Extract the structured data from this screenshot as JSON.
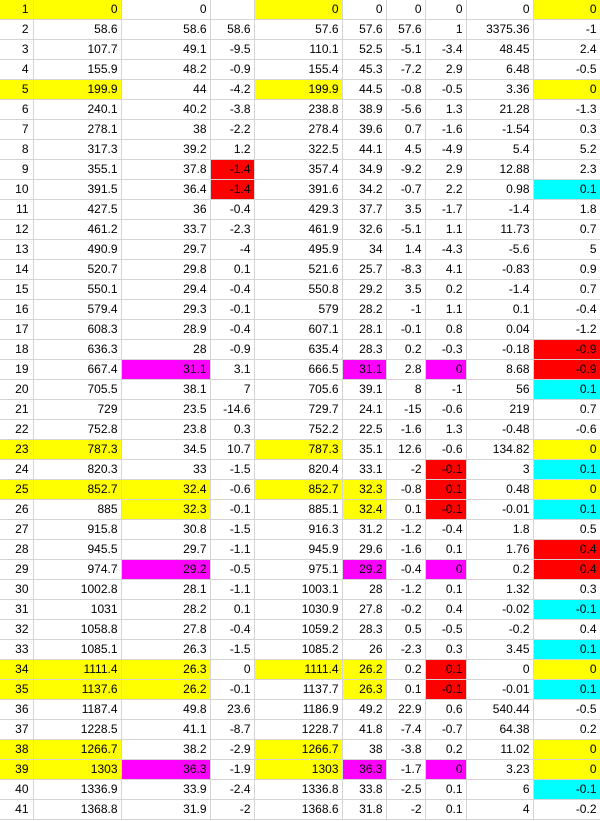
{
  "palette": {
    "Y": "#ffff00",
    "M": "#ff00ff",
    "R": "#ff0000",
    "C": "#00ffff"
  },
  "rows": [
    {
      "v": [
        "1",
        "0",
        "0",
        "",
        "0",
        "0",
        "0",
        "0",
        "0",
        "0"
      ],
      "h": [
        "Y",
        "Y",
        "",
        "",
        "Y",
        "",
        "",
        "",
        "",
        "Y"
      ]
    },
    {
      "v": [
        "2",
        "58.6",
        "58.6",
        "58.6",
        "57.6",
        "57.6",
        "57.6",
        "1",
        "3375.36",
        "-1"
      ],
      "h": [
        "",
        "",
        "",
        "",
        "",
        "",
        "",
        "",
        "",
        ""
      ]
    },
    {
      "v": [
        "3",
        "107.7",
        "49.1",
        "-9.5",
        "110.1",
        "52.5",
        "-5.1",
        "-3.4",
        "48.45",
        "2.4"
      ],
      "h": [
        "",
        "",
        "",
        "",
        "",
        "",
        "",
        "",
        "",
        ""
      ]
    },
    {
      "v": [
        "4",
        "155.9",
        "48.2",
        "-0.9",
        "155.4",
        "45.3",
        "-7.2",
        "2.9",
        "6.48",
        "-0.5"
      ],
      "h": [
        "",
        "",
        "",
        "",
        "",
        "",
        "",
        "",
        "",
        ""
      ]
    },
    {
      "v": [
        "5",
        "199.9",
        "44",
        "-4.2",
        "199.9",
        "44.5",
        "-0.8",
        "-0.5",
        "3.36",
        "0"
      ],
      "h": [
        "Y",
        "Y",
        "",
        "",
        "Y",
        "",
        "",
        "",
        "",
        "Y"
      ]
    },
    {
      "v": [
        "6",
        "240.1",
        "40.2",
        "-3.8",
        "238.8",
        "38.9",
        "-5.6",
        "1.3",
        "21.28",
        "-1.3"
      ],
      "h": [
        "",
        "",
        "",
        "",
        "",
        "",
        "",
        "",
        "",
        ""
      ]
    },
    {
      "v": [
        "7",
        "278.1",
        "38",
        "-2.2",
        "278.4",
        "39.6",
        "0.7",
        "-1.6",
        "-1.54",
        "0.3"
      ],
      "h": [
        "",
        "",
        "",
        "",
        "",
        "",
        "",
        "",
        "",
        ""
      ]
    },
    {
      "v": [
        "8",
        "317.3",
        "39.2",
        "1.2",
        "322.5",
        "44.1",
        "4.5",
        "-4.9",
        "5.4",
        "5.2"
      ],
      "h": [
        "",
        "",
        "",
        "",
        "",
        "",
        "",
        "",
        "",
        ""
      ]
    },
    {
      "v": [
        "9",
        "355.1",
        "37.8",
        "-1.4",
        "357.4",
        "34.9",
        "-9.2",
        "2.9",
        "12.88",
        "2.3"
      ],
      "h": [
        "",
        "",
        "",
        "R",
        "",
        "",
        "",
        "",
        "",
        ""
      ]
    },
    {
      "v": [
        "10",
        "391.5",
        "36.4",
        "-1.4",
        "391.6",
        "34.2",
        "-0.7",
        "2.2",
        "0.98",
        "0.1"
      ],
      "h": [
        "",
        "",
        "",
        "R",
        "",
        "",
        "",
        "",
        "",
        "C"
      ]
    },
    {
      "v": [
        "11",
        "427.5",
        "36",
        "-0.4",
        "429.3",
        "37.7",
        "3.5",
        "-1.7",
        "-1.4",
        "1.8"
      ],
      "h": [
        "",
        "",
        "",
        "",
        "",
        "",
        "",
        "",
        "",
        ""
      ]
    },
    {
      "v": [
        "12",
        "461.2",
        "33.7",
        "-2.3",
        "461.9",
        "32.6",
        "-5.1",
        "1.1",
        "11.73",
        "0.7"
      ],
      "h": [
        "",
        "",
        "",
        "",
        "",
        "",
        "",
        "",
        "",
        ""
      ]
    },
    {
      "v": [
        "13",
        "490.9",
        "29.7",
        "-4",
        "495.9",
        "34",
        "1.4",
        "-4.3",
        "-5.6",
        "5"
      ],
      "h": [
        "",
        "",
        "",
        "",
        "",
        "",
        "",
        "",
        "",
        ""
      ]
    },
    {
      "v": [
        "14",
        "520.7",
        "29.8",
        "0.1",
        "521.6",
        "25.7",
        "-8.3",
        "4.1",
        "-0.83",
        "0.9"
      ],
      "h": [
        "",
        "",
        "",
        "",
        "",
        "",
        "",
        "",
        "",
        ""
      ]
    },
    {
      "v": [
        "15",
        "550.1",
        "29.4",
        "-0.4",
        "550.8",
        "29.2",
        "3.5",
        "0.2",
        "-1.4",
        "0.7"
      ],
      "h": [
        "",
        "",
        "",
        "",
        "",
        "",
        "",
        "",
        "",
        ""
      ]
    },
    {
      "v": [
        "16",
        "579.4",
        "29.3",
        "-0.1",
        "579",
        "28.2",
        "-1",
        "1.1",
        "0.1",
        "-0.4"
      ],
      "h": [
        "",
        "",
        "",
        "",
        "",
        "",
        "",
        "",
        "",
        ""
      ]
    },
    {
      "v": [
        "17",
        "608.3",
        "28.9",
        "-0.4",
        "607.1",
        "28.1",
        "-0.1",
        "0.8",
        "0.04",
        "-1.2"
      ],
      "h": [
        "",
        "",
        "",
        "",
        "",
        "",
        "",
        "",
        "",
        ""
      ]
    },
    {
      "v": [
        "18",
        "636.3",
        "28",
        "-0.9",
        "635.4",
        "28.3",
        "0.2",
        "-0.3",
        "-0.18",
        "-0.9"
      ],
      "h": [
        "",
        "",
        "",
        "",
        "",
        "",
        "",
        "",
        "",
        "R"
      ]
    },
    {
      "v": [
        "19",
        "667.4",
        "31.1",
        "3.1",
        "666.5",
        "31.1",
        "2.8",
        "0",
        "8.68",
        "-0.9"
      ],
      "h": [
        "",
        "",
        "M",
        "",
        "",
        "M",
        "",
        "M",
        "",
        "R"
      ]
    },
    {
      "v": [
        "20",
        "705.5",
        "38.1",
        "7",
        "705.6",
        "39.1",
        "8",
        "-1",
        "56",
        "0.1"
      ],
      "h": [
        "",
        "",
        "",
        "",
        "",
        "",
        "",
        "",
        "",
        "C"
      ]
    },
    {
      "v": [
        "21",
        "729",
        "23.5",
        "-14.6",
        "729.7",
        "24.1",
        "-15",
        "-0.6",
        "219",
        "0.7"
      ],
      "h": [
        "",
        "",
        "",
        "",
        "",
        "",
        "",
        "",
        "",
        ""
      ]
    },
    {
      "v": [
        "22",
        "752.8",
        "23.8",
        "0.3",
        "752.2",
        "22.5",
        "-1.6",
        "1.3",
        "-0.48",
        "-0.6"
      ],
      "h": [
        "",
        "",
        "",
        "",
        "",
        "",
        "",
        "",
        "",
        ""
      ]
    },
    {
      "v": [
        "23",
        "787.3",
        "34.5",
        "10.7",
        "787.3",
        "35.1",
        "12.6",
        "-0.6",
        "134.82",
        "0"
      ],
      "h": [
        "Y",
        "Y",
        "",
        "",
        "Y",
        "",
        "",
        "",
        "",
        "Y"
      ]
    },
    {
      "v": [
        "24",
        "820.3",
        "33",
        "-1.5",
        "820.4",
        "33.1",
        "-2",
        "-0.1",
        "3",
        "0.1"
      ],
      "h": [
        "",
        "",
        "",
        "",
        "",
        "",
        "",
        "R",
        "",
        "C"
      ]
    },
    {
      "v": [
        "25",
        "852.7",
        "32.4",
        "-0.6",
        "852.7",
        "32.3",
        "-0.8",
        "0.1",
        "0.48",
        "0"
      ],
      "h": [
        "Y",
        "Y",
        "Y",
        "",
        "Y",
        "Y",
        "",
        "R",
        "",
        "Y"
      ]
    },
    {
      "v": [
        "26",
        "885",
        "32.3",
        "-0.1",
        "885.1",
        "32.4",
        "0.1",
        "-0.1",
        "-0.01",
        "0.1"
      ],
      "h": [
        "",
        "",
        "Y",
        "",
        "",
        "Y",
        "",
        "R",
        "",
        "C"
      ]
    },
    {
      "v": [
        "27",
        "915.8",
        "30.8",
        "-1.5",
        "916.3",
        "31.2",
        "-1.2",
        "-0.4",
        "1.8",
        "0.5"
      ],
      "h": [
        "",
        "",
        "",
        "",
        "",
        "",
        "",
        "",
        "",
        ""
      ]
    },
    {
      "v": [
        "28",
        "945.5",
        "29.7",
        "-1.1",
        "945.9",
        "29.6",
        "-1.6",
        "0.1",
        "1.76",
        "0.4"
      ],
      "h": [
        "",
        "",
        "",
        "",
        "",
        "",
        "",
        "",
        "",
        "R"
      ]
    },
    {
      "v": [
        "29",
        "974.7",
        "29.2",
        "-0.5",
        "975.1",
        "29.2",
        "-0.4",
        "0",
        "0.2",
        "0.4"
      ],
      "h": [
        "",
        "",
        "M",
        "",
        "",
        "M",
        "",
        "M",
        "",
        "R"
      ]
    },
    {
      "v": [
        "30",
        "1002.8",
        "28.1",
        "-1.1",
        "1003.1",
        "28",
        "-1.2",
        "0.1",
        "1.32",
        "0.3"
      ],
      "h": [
        "",
        "",
        "",
        "",
        "",
        "",
        "",
        "",
        "",
        ""
      ]
    },
    {
      "v": [
        "31",
        "1031",
        "28.2",
        "0.1",
        "1030.9",
        "27.8",
        "-0.2",
        "0.4",
        "-0.02",
        "-0.1"
      ],
      "h": [
        "",
        "",
        "",
        "",
        "",
        "",
        "",
        "",
        "",
        "C"
      ]
    },
    {
      "v": [
        "32",
        "1058.8",
        "27.8",
        "-0.4",
        "1059.2",
        "28.3",
        "0.5",
        "-0.5",
        "-0.2",
        "0.4"
      ],
      "h": [
        "",
        "",
        "",
        "",
        "",
        "",
        "",
        "",
        "",
        ""
      ]
    },
    {
      "v": [
        "33",
        "1085.1",
        "26.3",
        "-1.5",
        "1085.2",
        "26",
        "-2.3",
        "0.3",
        "3.45",
        "0.1"
      ],
      "h": [
        "",
        "",
        "",
        "",
        "",
        "",
        "",
        "",
        "",
        "C"
      ]
    },
    {
      "v": [
        "34",
        "1111.4",
        "26.3",
        "0",
        "1111.4",
        "26.2",
        "0.2",
        "0.1",
        "0",
        "0"
      ],
      "h": [
        "Y",
        "Y",
        "Y",
        "",
        "Y",
        "Y",
        "",
        "R",
        "",
        "Y"
      ]
    },
    {
      "v": [
        "35",
        "1137.6",
        "26.2",
        "-0.1",
        "1137.7",
        "26.3",
        "0.1",
        "-0.1",
        "-0.01",
        "0.1"
      ],
      "h": [
        "Y",
        "Y",
        "Y",
        "",
        "",
        "Y",
        "",
        "R",
        "",
        "C"
      ]
    },
    {
      "v": [
        "36",
        "1187.4",
        "49.8",
        "23.6",
        "1186.9",
        "49.2",
        "22.9",
        "0.6",
        "540.44",
        "-0.5"
      ],
      "h": [
        "",
        "",
        "",
        "",
        "",
        "",
        "",
        "",
        "",
        ""
      ]
    },
    {
      "v": [
        "37",
        "1228.5",
        "41.1",
        "-8.7",
        "1228.7",
        "41.8",
        "-7.4",
        "-0.7",
        "64.38",
        "0.2"
      ],
      "h": [
        "",
        "",
        "",
        "",
        "",
        "",
        "",
        "",
        "",
        ""
      ]
    },
    {
      "v": [
        "38",
        "1266.7",
        "38.2",
        "-2.9",
        "1266.7",
        "38",
        "-3.8",
        "0.2",
        "11.02",
        "0"
      ],
      "h": [
        "Y",
        "Y",
        "",
        "",
        "Y",
        "",
        "",
        "",
        "",
        "Y"
      ]
    },
    {
      "v": [
        "39",
        "1303",
        "36.3",
        "-1.9",
        "1303",
        "36.3",
        "-1.7",
        "0",
        "3.23",
        "0"
      ],
      "h": [
        "Y",
        "Y",
        "M",
        "",
        "Y",
        "M",
        "",
        "M",
        "",
        "Y"
      ]
    },
    {
      "v": [
        "40",
        "1336.9",
        "33.9",
        "-2.4",
        "1336.8",
        "33.8",
        "-2.5",
        "0.1",
        "6",
        "-0.1"
      ],
      "h": [
        "",
        "",
        "",
        "",
        "",
        "",
        "",
        "",
        "",
        "C"
      ]
    },
    {
      "v": [
        "41",
        "1368.8",
        "31.9",
        "-2",
        "1368.6",
        "31.8",
        "-2",
        "0.1",
        "4",
        "-0.2"
      ],
      "h": [
        "",
        "",
        "",
        "",
        "",
        "",
        "",
        "",
        "",
        ""
      ]
    }
  ]
}
